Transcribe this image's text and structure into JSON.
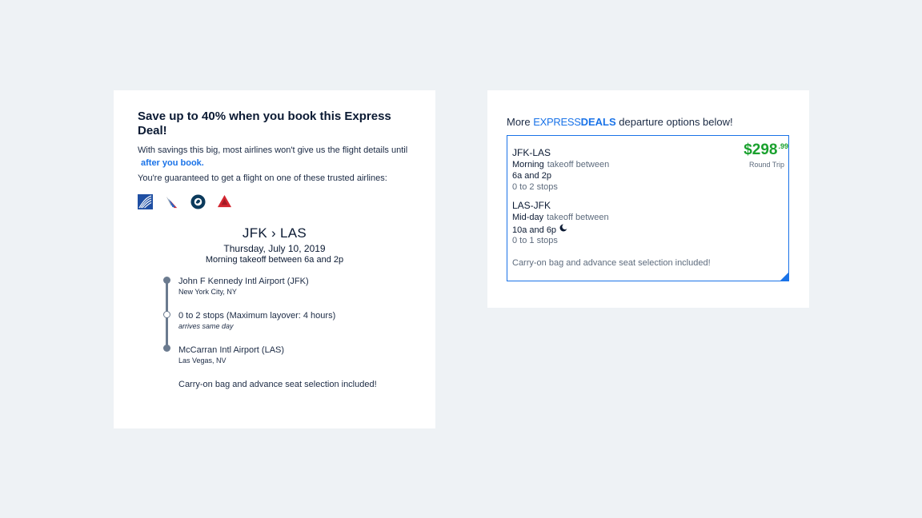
{
  "express_card": {
    "headline": "Save up to 40% when you book this Express Deal!",
    "description": "With savings this big, most airlines won't give us the flight details until",
    "description_link": "after you book.",
    "guarantee": "You're guaranteed to get a flight on one of these trusted airlines:",
    "airline_logos": [
      "united-icon",
      "american-icon",
      "alaska-icon",
      "delta-icon"
    ],
    "route": "JFK › LAS",
    "date": "Thursday, July 10, 2019",
    "time_window": "Morning takeoff between 6a and 2p",
    "timeline": [
      {
        "title": "John F Kennedy Intl Airport (JFK)",
        "subtitle": "New York City, NY"
      },
      {
        "title": "0 to 2 stops (Maximum layover: 4 hours)",
        "subtitle": "arrives same day"
      },
      {
        "title": "McCarran Intl Airport (LAS)",
        "subtitle": "Las Vegas, NV"
      }
    ],
    "note": "Carry-on bag and advance seat selection included!"
  },
  "deals_card": {
    "intro_prefix": "More",
    "intro_express": "EXPRESS",
    "intro_deals": "DEALS",
    "intro_suffix": "departure options below!",
    "deal": {
      "outbound_route": "JFK-LAS",
      "outbound_time_label": "Morning",
      "outbound_takeoff_text": "takeoff between",
      "outbound_window": "6a and 2p",
      "outbound_stops": "0 to 2 stops",
      "return_route": "LAS-JFK",
      "return_time_label": "Mid-day",
      "return_takeoff_text": "takeoff between",
      "return_window": "10a and 6p",
      "return_stops": "0 to 1 stops",
      "price_dollars": "$298",
      "price_cents": ".99",
      "trip_type": "Round Trip",
      "note": "Carry-on bag and advance seat selection included!"
    }
  },
  "colors": {
    "accent": "#1a73e8",
    "price": "#1aa12e",
    "background": "#eef2f5"
  }
}
